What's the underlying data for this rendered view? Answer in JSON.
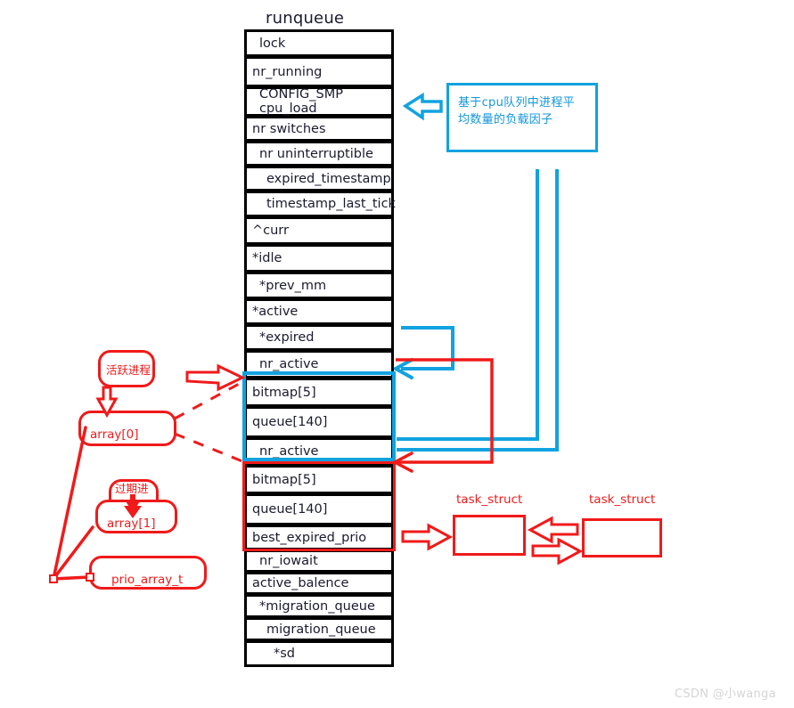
{
  "diagram": {
    "title": "runqueue",
    "struct_rows": [
      {
        "label": "lock",
        "height": 31,
        "indent": 1
      },
      {
        "label": "nr_running",
        "height": 35,
        "indent": 0
      },
      {
        "label": "CONFIG_SMP cpu_load",
        "height": 34,
        "indent": 1
      },
      {
        "label": "nr switches",
        "height": 29,
        "indent": 0
      },
      {
        "label": "nr uninterruptible",
        "height": 29,
        "indent": 1
      },
      {
        "label": "expired_timestamp",
        "height": 29,
        "indent": 2
      },
      {
        "label": "timestamp_last_tick",
        "height": 30,
        "indent": 2
      },
      {
        "label": "^curr",
        "height": 32,
        "indent": 0
      },
      {
        "label": "*idle",
        "height": 32,
        "indent": 0
      },
      {
        "label": "*prev_mm",
        "height": 31,
        "indent": 1
      },
      {
        "label": "*active",
        "height": 30,
        "indent": 0
      },
      {
        "label": "*expired",
        "height": 30,
        "indent": 1
      },
      {
        "label": "nr_active",
        "height": 32,
        "indent": 1
      },
      {
        "label": "bitmap[5]",
        "height": 33,
        "indent": 0
      },
      {
        "label": "queue[140]",
        "height": 36,
        "indent": 0
      },
      {
        "label": "nr_active",
        "height": 32,
        "indent": 1
      },
      {
        "label": "bitmap[5]",
        "height": 33,
        "indent": 0
      },
      {
        "label": "queue[140]",
        "height": 36,
        "indent": 0
      },
      {
        "label": "best_expired_prio",
        "height": 29,
        "indent": 0
      },
      {
        "label": "nr_iowait",
        "height": 26,
        "indent": 1
      },
      {
        "label": "active_balence",
        "height": 26,
        "indent": 0
      },
      {
        "label": "*migration_queue",
        "height": 27,
        "indent": 1
      },
      {
        "label": "migration_queue",
        "height": 27,
        "indent": 2
      },
      {
        "label": "*sd",
        "height": 30,
        "indent": 3
      }
    ],
    "note": {
      "line1": "基于cpu队列中进程平",
      "line2": "均数量的负载因子"
    },
    "callouts": {
      "active_process": "活跃进程",
      "array0": "array[0]",
      "expired_process": "过期进程",
      "array1": "array[1]",
      "prio_array_t": "prio_array_t"
    },
    "task_structs": [
      {
        "label": "task_struct"
      },
      {
        "label": "task_struct"
      }
    ],
    "watermark": "CSDN @小wanga",
    "colors": {
      "blue": "#11a2e0",
      "red": "#f01a1a",
      "black": "#000000",
      "text": "#1b1b2f",
      "watermark": "#d4d4d4"
    }
  }
}
